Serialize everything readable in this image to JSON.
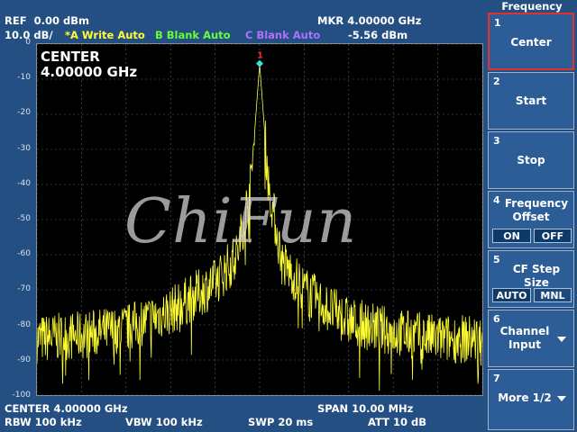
{
  "header": {
    "ref": "REF",
    "ref_value": "0.00 dBm",
    "scale": "10.0 dB/",
    "trace_a": "*A Write Auto",
    "trace_b": "B Blank Auto",
    "trace_c": "C Blank Auto",
    "mkr": "MKR",
    "mkr_freq": "4.00000 GHz",
    "mkr_level": "-5.56 dBm"
  },
  "plot": {
    "center_label": "CENTER",
    "center_value": "4.00000 GHz",
    "marker_label": "1",
    "watermark": "ChiFun",
    "y_ticks": [
      "0",
      "-10",
      "-20",
      "-30",
      "-40",
      "-50",
      "-60",
      "-70",
      "-80",
      "-90",
      "-100"
    ]
  },
  "footer": {
    "center": "CENTER 4.00000 GHz",
    "span": "SPAN 10.00 MHz",
    "rbw": "RBW 100 kHz",
    "vbw": "VBW  100 kHz",
    "swp": "SWP  20 ms",
    "att": "ATT 10 dB"
  },
  "softkeys": {
    "title": "Frequency",
    "keys": [
      {
        "num": "1",
        "label": "Center"
      },
      {
        "num": "2",
        "label": "Start"
      },
      {
        "num": "3",
        "label": "Stop"
      },
      {
        "num": "4",
        "label_1": "Frequency",
        "label_2": "Offset",
        "opt_a": "ON",
        "opt_b": "OFF"
      },
      {
        "num": "5",
        "label": "CF Step Size",
        "opt_a": "AUTO",
        "opt_b": "MNL"
      },
      {
        "num": "6",
        "label_1": "Channel",
        "label_2": "Input"
      },
      {
        "num": "7",
        "label": "More 1/2"
      }
    ]
  },
  "colors": {
    "background": "#244f82",
    "trace_a": "#ffff33",
    "trace_b": "#66ff33",
    "trace_c": "#b070ff",
    "marker": "#e03030"
  },
  "chart_data": {
    "type": "line",
    "x_unit": "GHz",
    "xlim": [
      3.995,
      4.005
    ],
    "ylim": [
      -100,
      0
    ],
    "y_unit": "dBm",
    "grid": true,
    "series": [
      {
        "name": "A",
        "peak": {
          "x": 4.0,
          "y": -5.56
        },
        "noise_floor_approx": -85,
        "points": [
          [
            3.995,
            -84
          ],
          [
            3.996,
            -83
          ],
          [
            3.997,
            -81
          ],
          [
            3.998,
            -76
          ],
          [
            3.9985,
            -72
          ],
          [
            3.999,
            -68
          ],
          [
            3.9995,
            -60
          ],
          [
            3.9998,
            -40
          ],
          [
            4.0,
            -5.56
          ],
          [
            4.0002,
            -40
          ],
          [
            4.0005,
            -62
          ],
          [
            4.001,
            -70
          ],
          [
            4.0015,
            -75
          ],
          [
            4.002,
            -79
          ],
          [
            4.003,
            -82
          ],
          [
            4.004,
            -84
          ],
          [
            4.005,
            -84
          ]
        ]
      }
    ]
  }
}
